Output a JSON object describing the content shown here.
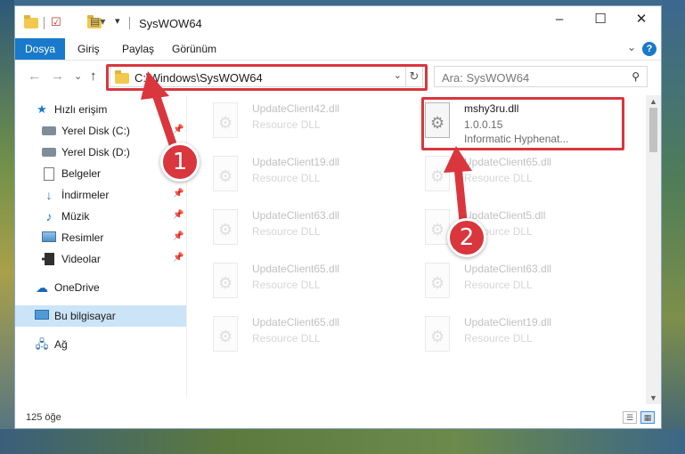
{
  "window": {
    "title": "SysWOW64",
    "controls": [
      "–",
      "☐",
      "✕"
    ]
  },
  "ribbon": {
    "tabs": [
      "Dosya",
      "Giriş",
      "Paylaş",
      "Görünüm"
    ],
    "expand": "⌄",
    "help": "?"
  },
  "nav": {
    "back": "←",
    "forward": "→",
    "recent": "⌄",
    "up": "↑",
    "address": "C:\\Windows\\SysWOW64",
    "address_dropdown": "⌄",
    "refresh": "↻",
    "search_placeholder": "Ara: SysWOW64",
    "search_icon": "search-icon"
  },
  "sidebar": {
    "items": [
      {
        "label": "Hızlı erişim",
        "icon": "star-icon"
      },
      {
        "label": "Yerel Disk (C:)",
        "icon": "drive-icon",
        "pinned": true
      },
      {
        "label": "Yerel Disk (D:)",
        "icon": "drive-icon"
      },
      {
        "label": "Belgeler",
        "icon": "document-icon"
      },
      {
        "label": "İndirmeler",
        "icon": "download-icon",
        "pinned": true
      },
      {
        "label": "Müzik",
        "icon": "music-icon",
        "pinned": true
      },
      {
        "label": "Resimler",
        "icon": "picture-icon",
        "pinned": true
      },
      {
        "label": "Videolar",
        "icon": "video-icon",
        "pinned": true
      },
      {
        "label": "OneDrive",
        "icon": "cloud-icon"
      },
      {
        "label": "Bu bilgisayar",
        "icon": "computer-icon",
        "selected": true
      },
      {
        "label": "Ağ",
        "icon": "network-icon"
      }
    ]
  },
  "files": [
    {
      "name": "UpdateClient42.dll",
      "type": "Resource DLL"
    },
    {
      "name": "mshy3ru.dll",
      "version": "1.0.0.15",
      "company": "Informatic Hyphenat..."
    },
    {
      "name": "UpdateClient19.dll",
      "type": "Resource DLL"
    },
    {
      "name": "UpdateClient65.dll",
      "type": "Resource DLL"
    },
    {
      "name": "UpdateClient63.dll",
      "type": "Resource DLL"
    },
    {
      "name": "UpdateClient5.dll",
      "type": "Resource DLL"
    },
    {
      "name": "UpdateClient65.dll",
      "type": "Resource DLL"
    },
    {
      "name": "UpdateClient63.dll",
      "type": "Resource DLL"
    },
    {
      "name": "UpdateClient65.dll",
      "type": "Resource DLL"
    },
    {
      "name": "UpdateClient19.dll",
      "type": "Resource DLL"
    }
  ],
  "status": {
    "count": "125 öğe"
  },
  "callouts": {
    "step1": "1",
    "step2": "2",
    "color": "#d9363e"
  }
}
